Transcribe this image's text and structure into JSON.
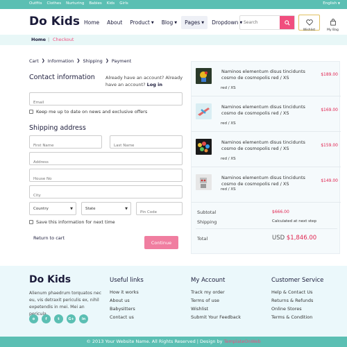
{
  "topbar": {
    "links": [
      "Outfits",
      "Clothes",
      "Nurturing",
      "Babies",
      "Kids",
      "Girls"
    ],
    "language": "English"
  },
  "header": {
    "logo": "Do Kids",
    "nav": [
      {
        "label": "Home",
        "dropdown": false
      },
      {
        "label": "About",
        "dropdown": false
      },
      {
        "label": "Product",
        "dropdown": true
      },
      {
        "label": "Blog",
        "dropdown": true
      },
      {
        "label": "Pages",
        "dropdown": true
      },
      {
        "label": "Dropdown",
        "dropdown": true
      }
    ],
    "active_nav": "Pages",
    "search_placeholder": "Search",
    "wishlist_label": "Wishlist",
    "bag_label": "My Bag",
    "accent": "#f04e7e"
  },
  "breadcrumb": {
    "home": "Home",
    "separator": "|",
    "current": "Checkout"
  },
  "steps": [
    "Cart",
    "Information",
    "Shipping",
    "Payment"
  ],
  "contact": {
    "title": "Contact information",
    "account_prompt": "Already have an account? Already have an account?",
    "login": "Log in",
    "email_placeholder": "Email",
    "newsletter_label": "Keep me up to date on news and exclusive offers"
  },
  "shipping": {
    "title": "Shipping address",
    "first_name": "First Name",
    "last_name": "Last Name",
    "address": "Address",
    "house_no": "House No",
    "city": "City",
    "country": "Country",
    "state": "State",
    "pin_code": "Pin Code",
    "save_label": "Save this information for next time"
  },
  "actions": {
    "return": "Return to cart",
    "continue": "Continue"
  },
  "order": {
    "items": [
      {
        "name": "Naminos elementum disus tincidunts cosmo de cosmopolis red / XS",
        "variant": "red / XS",
        "price": "$189.00",
        "thumb": "toy-figure"
      },
      {
        "name": "Naminos elementum disus tincidunts cosmo de cosmopolis red / XS",
        "variant": "red / XS",
        "price": "$169.00",
        "thumb": "toy-plane"
      },
      {
        "name": "Naminos elementum disus tincidunts cosmo de cosmopolis red / XS",
        "variant": "red / XS",
        "price": "$159.00",
        "thumb": "toy-balloons"
      },
      {
        "name": "Naminos elementum disus tincidunts cosmo de cosmopolis red / XS",
        "variant": "red / XS",
        "price": "$149.00",
        "thumb": "toy-robot"
      }
    ],
    "subtotal_label": "Subtotal",
    "subtotal": "$666.00",
    "shipping_label": "Shipping",
    "shipping": "Calculated at next step",
    "total_label": "Total",
    "currency": "USD",
    "total": "$1,846.00"
  },
  "footer": {
    "logo": "Do Kids",
    "about": "Alienum phaedrum torquatos nec eu, vis detraxit periculis ex, nihil expetendis in mei. Mei an pericula.",
    "socials": [
      "rss-icon",
      "facebook-icon",
      "twitter-icon",
      "google-plus-icon",
      "linkedin-icon"
    ],
    "useful_links": {
      "title": "Useful links",
      "links": [
        "How it works",
        "About us",
        "Babysitters",
        "Contact us"
      ]
    },
    "my_account": {
      "title": "My Account",
      "links": [
        "Track my order",
        "Terms of use",
        "Wishlist",
        "Submit Your Feedback"
      ]
    },
    "customer_service": {
      "title": "Customer Service",
      "links": [
        "Help & Contact Us",
        "Returns & Refunds",
        "Online Stores",
        "Terms & Condition"
      ]
    },
    "copyright": "© 2013 Your Website Name. All Rights Reserved | Design by",
    "designer": "TemplateOnWeb"
  }
}
